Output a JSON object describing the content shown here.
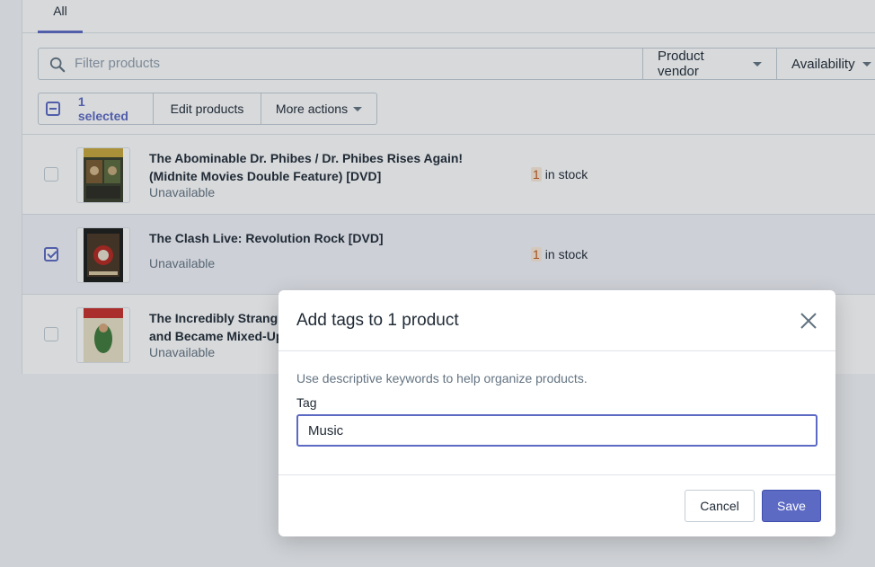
{
  "tabs": {
    "all_label": "All"
  },
  "filter": {
    "placeholder": "Filter products",
    "vendor_label": "Product vendor",
    "availability_label": "Availability"
  },
  "bulk": {
    "selected_label": "1 selected",
    "edit_label": "Edit products",
    "more_label": "More actions"
  },
  "products": [
    {
      "title": "The Abominable Dr. Phibes / Dr. Phibes Rises Again! (Midnite Movies Double Feature) [DVD]",
      "status": "Unavailable",
      "stock_count": "1",
      "stock_text": "in stock",
      "selected": false
    },
    {
      "title": "The Clash Live: Revolution Rock [DVD]",
      "status": "Unavailable",
      "stock_count": "1",
      "stock_text": "in stock",
      "selected": true
    },
    {
      "title": "The Incredibly Strang",
      "title_line2": "and Became Mixed-Up",
      "status": "Unavailable",
      "selected": false
    }
  ],
  "modal": {
    "title": "Add tags to 1 product",
    "help_text": "Use descriptive keywords to help organize products.",
    "tag_label": "Tag",
    "tag_value": "Music",
    "cancel_label": "Cancel",
    "save_label": "Save"
  },
  "colors": {
    "accent": "#5c6ac4",
    "stock_badge_bg": "#fcebdb",
    "stock_badge_text": "#c05717"
  }
}
